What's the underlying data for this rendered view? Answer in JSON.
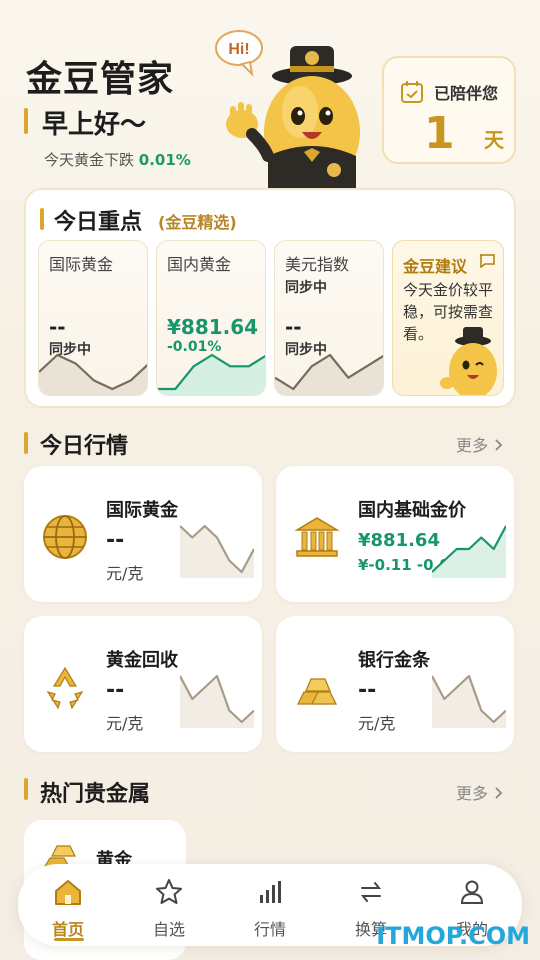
{
  "header": {
    "app_title": "金豆管家",
    "greeting": "早上好～",
    "trend_prefix": "今天黄金下跌",
    "trend_pct": "0.01%",
    "mascot_bubble": "Hi!",
    "companion_label": "已陪伴您",
    "companion_days": "1",
    "companion_unit": "天"
  },
  "key_points": {
    "title": "今日重点",
    "subtitle": "(金豆精选)",
    "items": [
      {
        "name": "国际黄金",
        "value": "--",
        "change": "同步中",
        "trend": [
          3,
          5,
          4,
          2,
          1,
          2,
          4
        ],
        "direction": "flat"
      },
      {
        "name": "国内黄金",
        "value": "¥881.64",
        "change": "-0.01%",
        "trend": [
          1,
          1,
          3,
          4,
          3,
          3,
          4
        ],
        "direction": "down"
      },
      {
        "name": "美元指数",
        "value": "--",
        "change": "同步中",
        "trend": [
          2,
          1,
          3,
          4,
          2,
          3,
          4
        ],
        "direction": "flat",
        "status_top": "同步中"
      }
    ],
    "advice": {
      "title": "金豆建议",
      "body": "今天金价较平稳，可按需查看。"
    }
  },
  "market": {
    "title": "今日行情",
    "more": "更多",
    "items": [
      {
        "name": "国际黄金",
        "value": "--",
        "unit": "元/克",
        "icon": "globe-icon",
        "trend": [
          4,
          3,
          4,
          3,
          1,
          0,
          2
        ]
      },
      {
        "name": "国内基础金价",
        "value": "¥881.64",
        "unit": "¥-0.11  -0.01%",
        "icon": "bank-icon",
        "trend": [
          0,
          1,
          2,
          2,
          3,
          2,
          4
        ],
        "up": true
      },
      {
        "name": "黄金回收",
        "value": "--",
        "unit": "元/克",
        "icon": "recycle-icon",
        "trend": [
          4,
          2,
          3,
          4,
          1,
          0,
          1
        ]
      },
      {
        "name": "银行金条",
        "value": "--",
        "unit": "元/克",
        "icon": "gold-bars-icon",
        "trend": [
          4,
          2,
          3,
          4,
          1,
          0,
          1
        ]
      }
    ]
  },
  "hot_metals": {
    "title": "热门贵金属",
    "more": "更多",
    "items": [
      {
        "name": "黄金"
      }
    ]
  },
  "nav": {
    "items": [
      {
        "label": "首页",
        "icon": "home-icon",
        "active": true
      },
      {
        "label": "自选",
        "icon": "star-icon"
      },
      {
        "label": "行情",
        "icon": "bar-chart-icon"
      },
      {
        "label": "换算",
        "icon": "exchange-icon"
      },
      {
        "label": "我的",
        "icon": "user-icon"
      }
    ]
  },
  "watermark": "ITMOP.COM",
  "colors": {
    "accent": "#d9a72a",
    "gold_text": "#c8961f",
    "rise_green": "#16966a"
  }
}
